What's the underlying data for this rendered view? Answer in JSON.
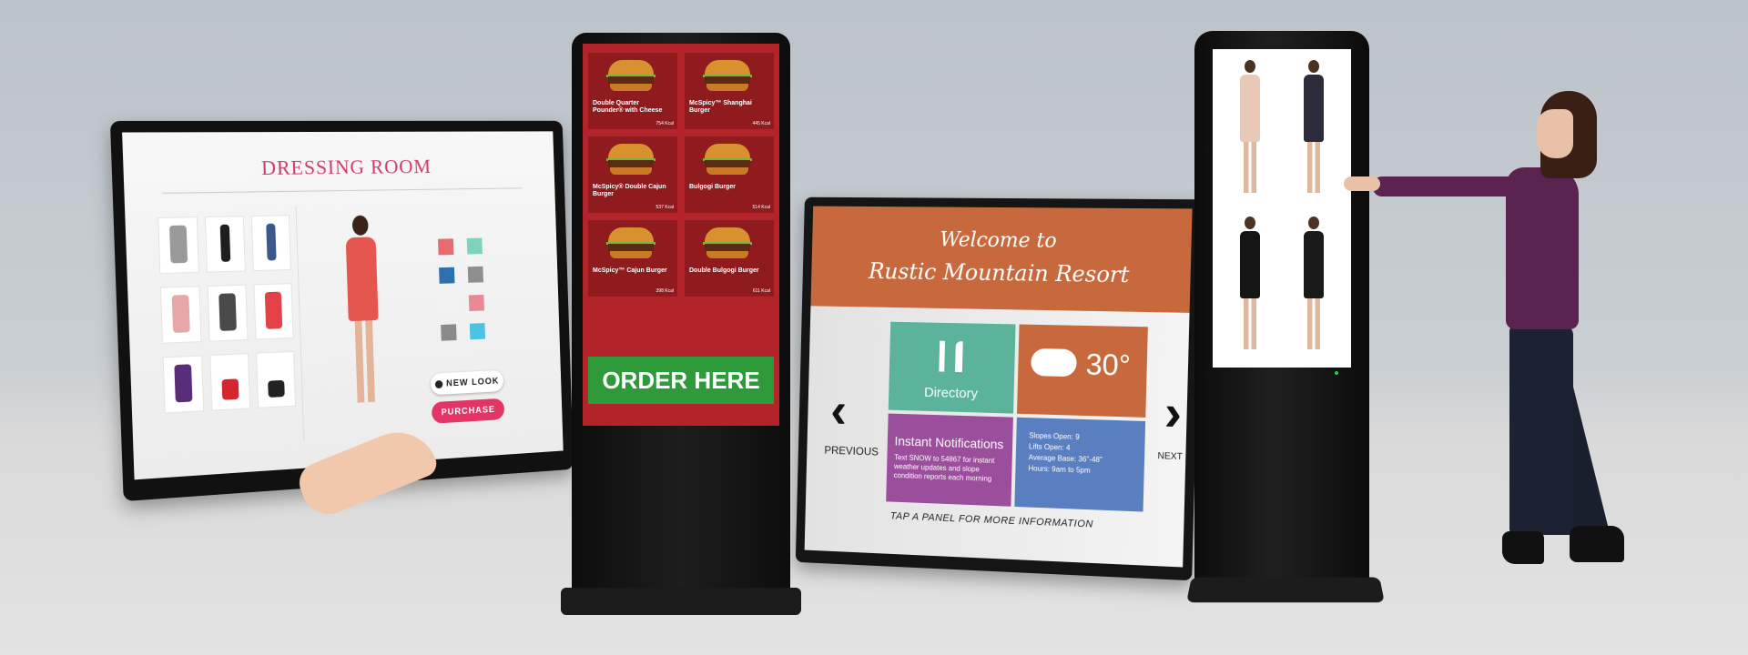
{
  "dressing_room": {
    "title": "DRESSING ROOM",
    "new_look_label": "NEW LOOK",
    "purchase_label": "PURCHASE",
    "swatch_colors": [
      "#e76b6f",
      "#7fd3bd",
      "#2f6fae",
      "#8f8f8f",
      "#f2f2f2",
      "#e88a96",
      "#8a8a8a",
      "#4bc3e3"
    ],
    "accent_color": "#e23565"
  },
  "menu_kiosk": {
    "items": [
      {
        "name": "Double Quarter Pounder® with Cheese",
        "kcal": "754 Kcal"
      },
      {
        "name": "McSpicy™ Shanghai Burger",
        "kcal": "445 Kcal"
      },
      {
        "name": "McSpicy® Double Cajun Burger",
        "kcal": "537 Kcal"
      },
      {
        "name": "Bulgogi Burger",
        "kcal": "514 Kcal"
      },
      {
        "name": "McSpicy™ Cajun Burger",
        "kcal": "398 Kcal"
      },
      {
        "name": "Double Bulgogi Burger",
        "kcal": "611 Kcal"
      }
    ],
    "order_label": "ORDER HERE",
    "background_color": "#b3242a",
    "order_color": "#2f9a3a"
  },
  "resort_display": {
    "welcome_line": "Welcome to",
    "resort_name": "Rustic Mountain Resort",
    "directory_label": "Directory",
    "temperature": "30°",
    "notifications_title": "Instant Notifications",
    "notifications_body": "Text SNOW to 54867 for instant weather updates and slope condition reports each morning",
    "slopes_info": [
      "Slopes Open: 9",
      "Lifts Open: 4",
      "Average Base: 36\"-48\"",
      "Hours: 9am to 5pm"
    ],
    "previous_label": "PREVIOUS",
    "next_label": "NEXT",
    "footer_text": "TAP A PANEL FOR MORE INFORMATION"
  },
  "fashion_kiosk": {
    "dress_colors": [
      "#e8c9b8",
      "#2b2b3a",
      "#151515",
      "#1a1a1a"
    ]
  }
}
